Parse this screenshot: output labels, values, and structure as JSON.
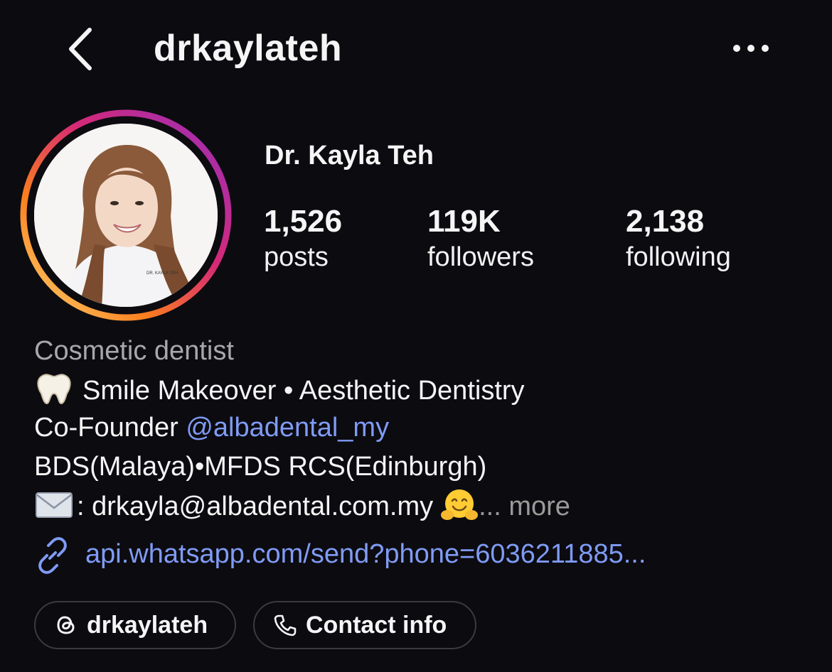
{
  "header": {
    "back_icon": "chevron-left-icon",
    "username": "drkaylateh",
    "more_icon": "more-horizontal-icon"
  },
  "profile": {
    "display_name": "Dr. Kayla Teh",
    "avatar_shirt_text": "DR. KAYLA TEH",
    "stats": {
      "posts": {
        "value": "1,526",
        "label": "posts"
      },
      "followers": {
        "value": "119K",
        "label": "followers"
      },
      "following": {
        "value": "2,138",
        "label": "following"
      }
    }
  },
  "bio": {
    "category": "Cosmetic dentist",
    "line1": "Smile Makeover • Aesthetic Dentistry",
    "line2_prefix": "Co-Founder ",
    "line2_mention": "@albadental_my",
    "line3": "BDS(Malaya)•MFDS RCS(Edinburgh)",
    "line4": ": drkayla@albadental.com.my",
    "more_label": "... more",
    "link": "api.whatsapp.com/send?phone=6036211885..."
  },
  "buttons": {
    "threads_label": "drkaylateh",
    "contact_label": "Contact info"
  },
  "colors": {
    "background": "#0c0b10",
    "link": "#7f9bf4",
    "muted": "#a8a8a8"
  }
}
